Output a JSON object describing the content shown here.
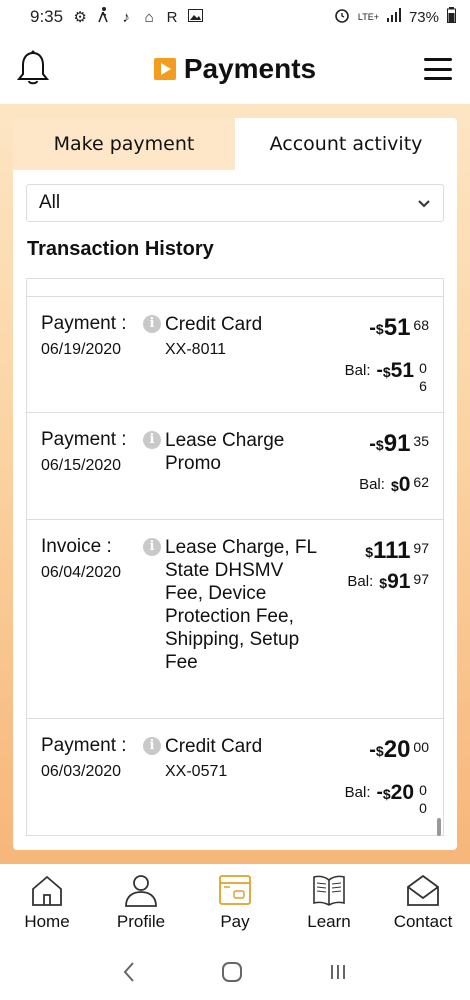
{
  "status_bar": {
    "time": "9:35",
    "signal_text": "LTE+",
    "battery": "73%",
    "left_glyphs": [
      "⚙",
      "🚶",
      "♪",
      "⌂",
      "R"
    ]
  },
  "header": {
    "title": "Payments",
    "brand_color": "#f39c1f"
  },
  "tabs": [
    {
      "label": "Make payment",
      "active": true
    },
    {
      "label": "Account activity",
      "active": false
    }
  ],
  "filter": {
    "selected": "All"
  },
  "section_title": "Transaction History",
  "transactions": [
    {
      "type": "Payment :",
      "date": "06/19/2020",
      "description": "Credit Card",
      "account": "XX-8011",
      "amount": {
        "sign": "-",
        "currency": "$",
        "whole": "51",
        "cents": "68"
      },
      "balance": {
        "label": "Bal:",
        "sign": "-",
        "currency": "$",
        "whole": "51",
        "cents": "06"
      }
    },
    {
      "type": "Payment :",
      "date": "06/15/2020",
      "description": "Lease Charge Promo",
      "account": "",
      "amount": {
        "sign": "-",
        "currency": "$",
        "whole": "91",
        "cents": "35"
      },
      "balance": {
        "label": "Bal:",
        "sign": "",
        "currency": "$",
        "whole": "0",
        "cents": "62"
      }
    },
    {
      "type": "Invoice :",
      "date": "06/04/2020",
      "description": "Lease Charge, FL State DHSMV Fee, Device Protection Fee, Shipping, Setup Fee",
      "account": "",
      "amount": {
        "sign": "",
        "currency": "$",
        "whole": "111",
        "cents": "97"
      },
      "balance": {
        "label": "Bal:",
        "sign": "",
        "currency": "$",
        "whole": "91",
        "cents": "97"
      }
    },
    {
      "type": "Payment :",
      "date": "06/03/2020",
      "description": "Credit Card",
      "account": "XX-0571",
      "amount": {
        "sign": "-",
        "currency": "$",
        "whole": "20",
        "cents": "00"
      },
      "balance": {
        "label": "Bal:",
        "sign": "-",
        "currency": "$",
        "whole": "20",
        "cents": "00"
      }
    }
  ],
  "bottom_nav": [
    {
      "label": "Home",
      "icon": "home-icon",
      "active": false
    },
    {
      "label": "Profile",
      "icon": "profile-icon",
      "active": false
    },
    {
      "label": "Pay",
      "icon": "pay-icon",
      "active": true
    },
    {
      "label": "Learn",
      "icon": "learn-icon",
      "active": false
    },
    {
      "label": "Contact",
      "icon": "contact-icon",
      "active": false
    }
  ],
  "colors": {
    "accent": "#f39c1f",
    "active_icon": "#e0a02a",
    "tab_active_bg": "#fde7c8"
  }
}
